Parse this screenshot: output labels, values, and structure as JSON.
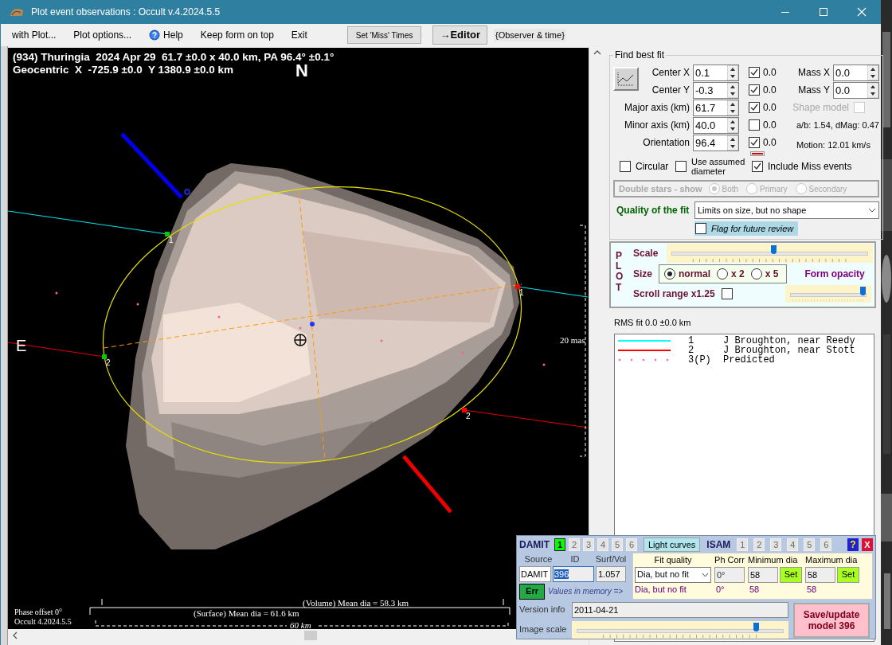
{
  "window": {
    "title": "Plot event observations : Occult v.4.2024.5.5"
  },
  "menu": [
    {
      "label": "with Plot...",
      "kind": "text"
    },
    {
      "label": "Plot options...",
      "kind": "text"
    },
    {
      "label": "Help",
      "kind": "help"
    },
    {
      "label": "Keep form on top",
      "kind": "text"
    },
    {
      "label": "Exit",
      "kind": "text"
    }
  ],
  "set_miss_button": "Set 'Miss' Times",
  "editor_button": "→Editor",
  "observer_label": "{Observer & time}",
  "plot": {
    "header": [
      "(934) Thuringia  2024 Apr 29  61.7 ±0.0 x 40.0 km, PA 96.4° ±0.1°",
      "Geocentric  X  -725.9 ±0.0  Y 1380.9 ±0.0 km"
    ],
    "north": "N",
    "east": "E",
    "chord_marks": [
      {
        "label": "1",
        "color": "#00cc00"
      },
      {
        "label": "1",
        "color": "#ff0000"
      },
      {
        "label": "2",
        "color": "#00cc00"
      },
      {
        "label": "2",
        "color": "#ff0000"
      }
    ],
    "scale_label": "20 mas",
    "volume_label": "(Volume) Mean dia = 58.3 km",
    "surface_label": "(Surface) Mean dia = 61.6 km",
    "scale_bar": "60 km",
    "phase_offset": "Phase offset 0°",
    "version": "Occult 4.2024.5.5"
  },
  "fit": {
    "title": "Find best fit",
    "params": [
      {
        "label": "Center X",
        "value": "0.1",
        "checked": true,
        "reading": "0.0"
      },
      {
        "label": "Center Y",
        "value": "-0.3",
        "checked": true,
        "reading": "0.0"
      },
      {
        "label": "Major axis (km)",
        "value": "61.7",
        "checked": true,
        "reading": "0.0"
      },
      {
        "label": "Minor axis (km)",
        "value": "40.0",
        "checked": false,
        "reading": "0.0"
      },
      {
        "label": "Orientation",
        "value": "96.4",
        "checked": true,
        "reading": "0.0"
      }
    ],
    "mass": [
      {
        "label": "Mass X",
        "value": "0.0"
      },
      {
        "label": "Mass Y",
        "value": "0.0"
      }
    ],
    "shape_model": {
      "label": "Shape model",
      "checked": false,
      "disabled": true
    },
    "ratio": "a/b: 1.54, dMag: 0.47",
    "motion": "Motion: 12.01 km/s",
    "options": [
      {
        "label": "Circular",
        "checked": false
      },
      {
        "label": "Use assumed diameter",
        "checked": false
      },
      {
        "label": "Include Miss events",
        "checked": true
      }
    ],
    "double_stars": {
      "label": "Double stars - show",
      "disabled": true,
      "options": [
        {
          "label": "Both",
          "selected": true
        },
        {
          "label": "Primary",
          "selected": false
        },
        {
          "label": "Secondary",
          "selected": false
        }
      ]
    },
    "quality": {
      "label": "Quality of the fit",
      "value": "Limits on size, but no shape"
    },
    "flag": {
      "label": "Flag for future review",
      "checked": false
    }
  },
  "plot_options": {
    "title": "PLOT",
    "scale": {
      "label": "Scale",
      "level": 0.52
    },
    "size": {
      "label": "Size",
      "options": [
        {
          "label": "normal",
          "selected": true
        },
        {
          "label": "x 2",
          "selected": false
        },
        {
          "label": "x 5",
          "selected": false
        }
      ]
    },
    "opacity": {
      "label": "Form opacity",
      "level": 1.0
    },
    "scroll_range": {
      "label": "Scroll range x1.25",
      "checked": false
    }
  },
  "rms": "RMS fit 0.0 ±0.0 km",
  "legend": [
    {
      "kind": "line",
      "color": "#00ffff",
      "number": "1",
      "name": "J Broughton, near Reedy"
    },
    {
      "kind": "line",
      "color": "#ff0000",
      "number": "2",
      "name": "J Broughton, near Stott"
    },
    {
      "kind": "dots",
      "color": "#ff69b4",
      "number": "3(P)",
      "name": "Predicted"
    }
  ],
  "damit": {
    "title": "DAMIT",
    "tabs": [
      {
        "label": "1",
        "selected": true
      },
      {
        "label": "2",
        "selected": false
      },
      {
        "label": "3",
        "selected": false
      },
      {
        "label": "4",
        "selected": false
      },
      {
        "label": "5",
        "selected": false
      },
      {
        "label": "6",
        "selected": false
      }
    ],
    "light_curves": "Light curves",
    "isam_title": "ISAM",
    "isam_tabs": [
      {
        "label": "1",
        "selected": false
      },
      {
        "label": "2",
        "selected": false
      },
      {
        "label": "3",
        "selected": false
      },
      {
        "label": "4",
        "selected": false
      },
      {
        "label": "5",
        "selected": false
      },
      {
        "label": "6",
        "selected": false
      }
    ],
    "help": "?",
    "close": "X",
    "source": {
      "label": "Source",
      "value": "DAMIT"
    },
    "id": {
      "label": "ID",
      "value": "396"
    },
    "surf_vol": {
      "label": "Surf/Vol",
      "value": "1.057"
    },
    "err": "Err",
    "memory_label": "Values in memory =>",
    "fit_quality": {
      "label": "Fit quality",
      "value": "Dia, but no fit",
      "memory": "Dia, but no fit"
    },
    "ph_corr": {
      "label": "Ph Corr",
      "value": "0°",
      "memory": "0°"
    },
    "min_dia": {
      "label": "Minimum dia",
      "value": "58",
      "button": "Set",
      "memory": "58"
    },
    "max_dia": {
      "label": "Maximum dia",
      "value": "58",
      "button": "Set",
      "memory": "58"
    },
    "version": {
      "label": "Version info",
      "value": "2011-04-21"
    },
    "image_scale": {
      "label": "Image scale",
      "level": 0.88
    },
    "save": "Save/update model 396"
  }
}
